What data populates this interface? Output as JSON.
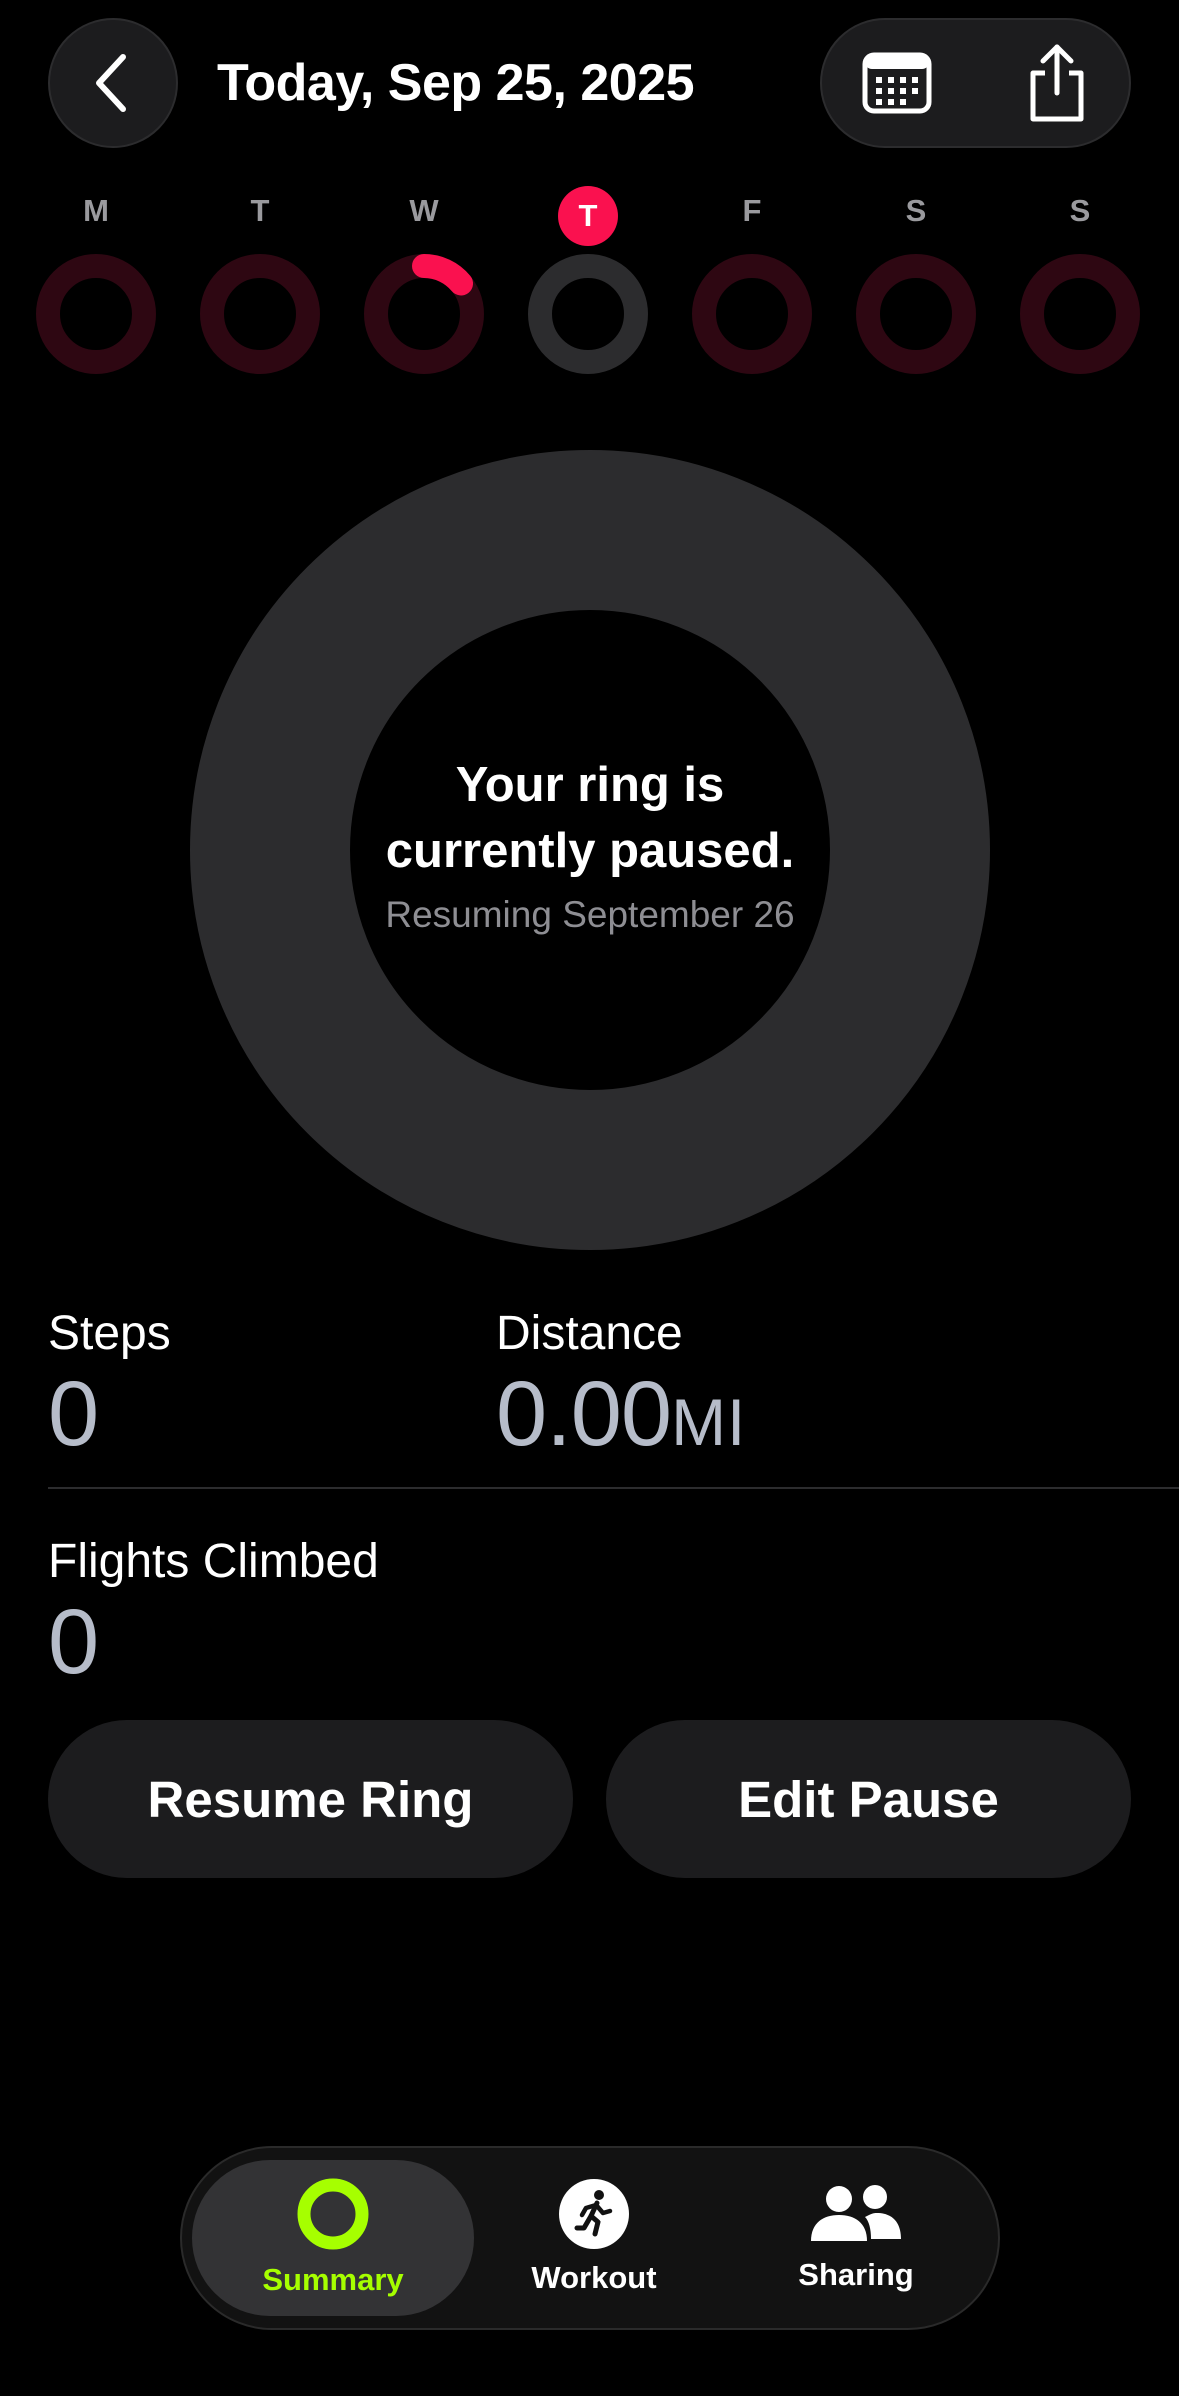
{
  "header": {
    "title": "Today, Sep 25, 2025",
    "back_icon": "chevron-left-icon",
    "calendar_icon": "calendar-icon",
    "share_icon": "share-icon"
  },
  "week": {
    "days": [
      {
        "letter": "M",
        "progress": 0,
        "today": false
      },
      {
        "letter": "T",
        "progress": 0,
        "today": false
      },
      {
        "letter": "W",
        "progress": 0.14,
        "today": false
      },
      {
        "letter": "T",
        "progress": 0,
        "today": true
      },
      {
        "letter": "F",
        "progress": 0,
        "today": false
      },
      {
        "letter": "S",
        "progress": 0,
        "today": false
      },
      {
        "letter": "S",
        "progress": 0,
        "today": false
      }
    ]
  },
  "ring": {
    "title_line1": "Your ring is",
    "title_line2": "currently paused.",
    "subtitle": "Resuming September 26"
  },
  "stats": {
    "steps_label": "Steps",
    "steps_value": "0",
    "distance_label": "Distance",
    "distance_value": "0.00",
    "distance_unit": "MI",
    "flights_label": "Flights Climbed",
    "flights_value": "0"
  },
  "actions": {
    "resume_label": "Resume Ring",
    "edit_label": "Edit Pause"
  },
  "tabs": {
    "summary": "Summary",
    "workout": "Workout",
    "sharing": "Sharing"
  },
  "colors": {
    "move_red": "#fa114f",
    "move_red_dim": "#2e0712",
    "summary_green": "#a6ff00",
    "paused_gray": "#2c2c2e"
  }
}
